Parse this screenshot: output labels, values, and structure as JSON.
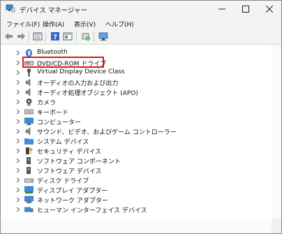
{
  "window": {
    "title": "デバイス マネージャー"
  },
  "menu": [
    "ファイル(F)",
    "操作(A)",
    "表示(V)",
    "ヘルプ(H)"
  ],
  "toolbar_icons": [
    "back-arrow-icon",
    "forward-arrow-icon",
    "properties-grid-icon",
    "help-icon",
    "show-panel-icon",
    "scan-hardware-icon",
    "monitor-icon"
  ],
  "tree": {
    "items": [
      {
        "label": "Bluetooth",
        "icon": "bluetooth-icon"
      },
      {
        "label": "DVD/CD-ROM ドライブ",
        "icon": "dvd-drive-icon",
        "highlighted": true
      },
      {
        "label": "Virtual Display Device Class",
        "icon": "usb-plug-icon"
      },
      {
        "label": "オーディオの入力および出力",
        "icon": "speaker-icon"
      },
      {
        "label": "オーディオ処理オブジェクト (APO)",
        "icon": "speaker-icon"
      },
      {
        "label": "カメラ",
        "icon": "camera-icon"
      },
      {
        "label": "キーボード",
        "icon": "keyboard-icon"
      },
      {
        "label": "コンピューター",
        "icon": "computer-icon"
      },
      {
        "label": "サウンド、ビデオ、およびゲーム コントローラー",
        "icon": "speaker-icon"
      },
      {
        "label": "システム デバイス",
        "icon": "folder-icon"
      },
      {
        "label": "セキュリティ デバイス",
        "icon": "security-key-icon"
      },
      {
        "label": "ソフトウェア コンポーネント",
        "icon": "software-component-icon"
      },
      {
        "label": "ソフトウェア デバイス",
        "icon": "software-device-icon"
      },
      {
        "label": "ディスク ドライブ",
        "icon": "disk-drive-icon"
      },
      {
        "label": "ディスプレイ アダプター",
        "icon": "display-adapter-icon"
      },
      {
        "label": "ネットワーク アダプター",
        "icon": "network-adapter-icon"
      },
      {
        "label": "ヒューマン インターフェイス デバイス",
        "icon": "hid-icon"
      }
    ]
  }
}
